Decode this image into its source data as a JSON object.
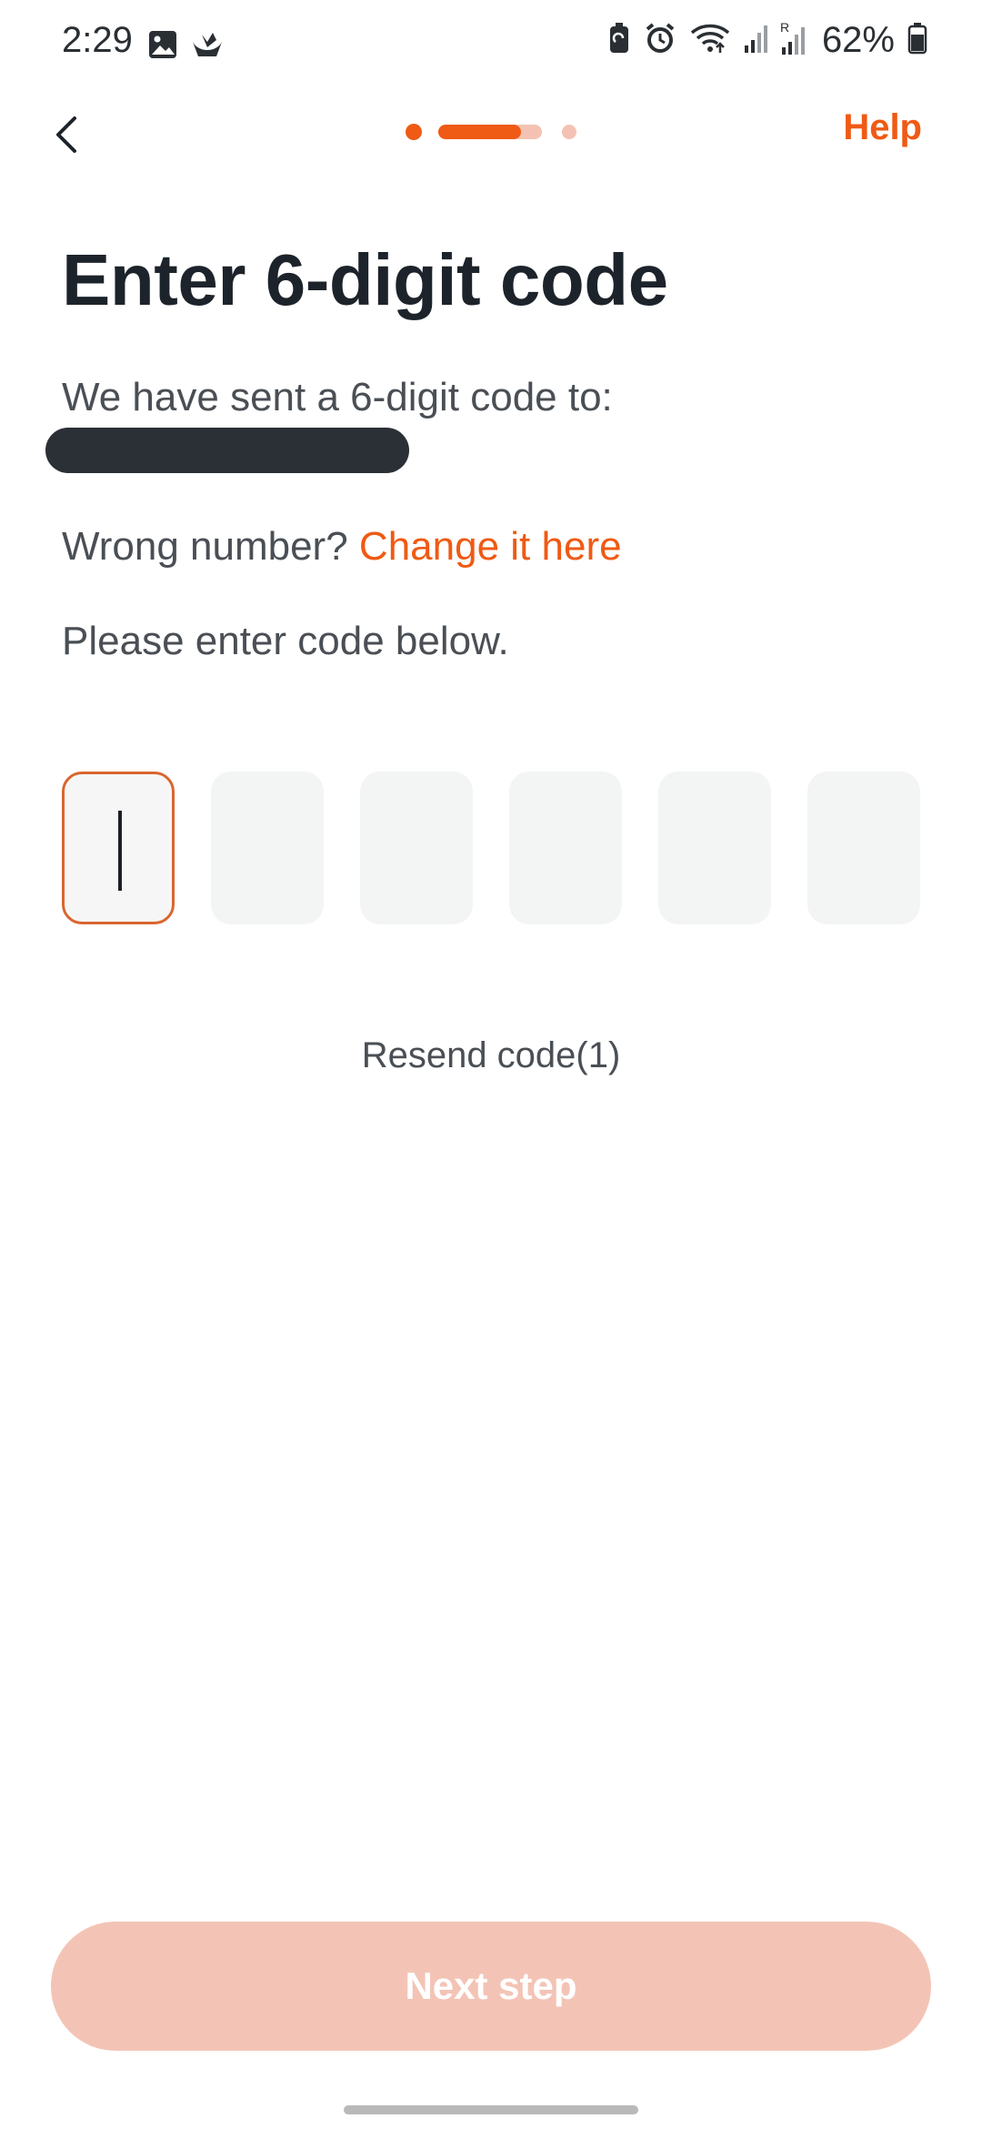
{
  "status_bar": {
    "time": "2:29",
    "battery_percent": "62%",
    "icons": [
      "gallery-icon",
      "app-notification-icon",
      "battery-saver-icon",
      "alarm-icon",
      "wifi-icon",
      "signal-icon",
      "roaming-signal-icon",
      "battery-icon"
    ]
  },
  "nav": {
    "help_label": "Help",
    "progress_step_fraction": 0.8
  },
  "content": {
    "title": "Enter 6-digit code",
    "sent_text": "We have sent a 6-digit code to:",
    "wrong_number_text": "Wrong number?",
    "change_link_text": "Change it here",
    "enter_text": "Please enter code below.",
    "resend_text": "Resend code(1)"
  },
  "code_boxes": [
    "",
    "",
    "",
    "",
    "",
    ""
  ],
  "footer": {
    "next_label": "Next step"
  },
  "colors": {
    "accent": "#ef5a14",
    "accent_light": "#f4c2b2",
    "button_disabled": "#f3c4b6",
    "text_dark": "#1d232a",
    "text_muted": "#4a4f55"
  }
}
